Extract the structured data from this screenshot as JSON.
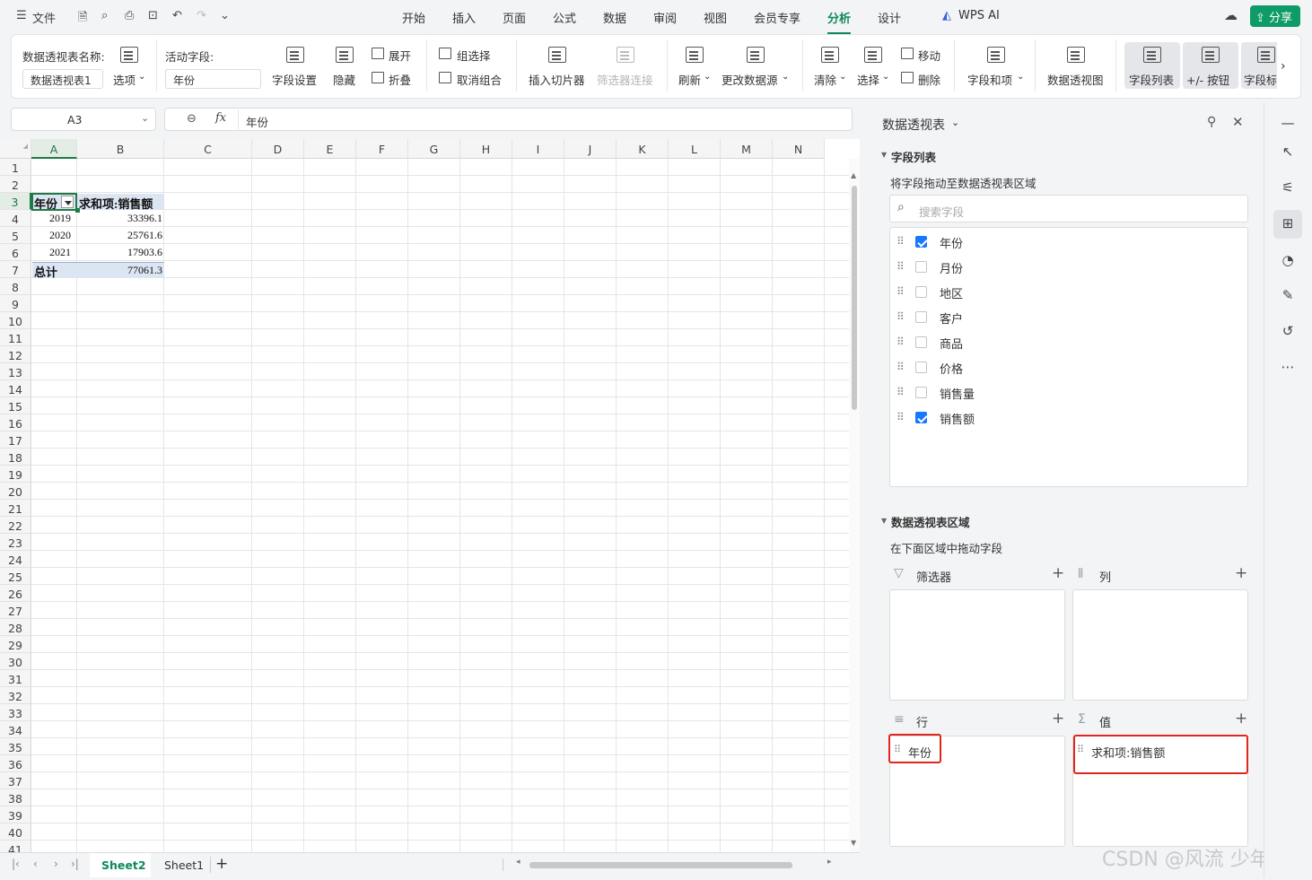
{
  "topbar": {
    "file_label": "文件",
    "tabs": [
      "开始",
      "插入",
      "页面",
      "公式",
      "数据",
      "审阅",
      "视图",
      "会员专享",
      "分析",
      "设计"
    ],
    "active_tab": "分析",
    "wps_ai": "WPS AI",
    "share": "分享"
  },
  "ribbon": {
    "pivot_name_label": "数据透视表名称:",
    "pivot_name_value": "数据透视表1",
    "options": "选项",
    "active_field_label": "活动字段:",
    "active_field_value": "年份",
    "field_settings": "字段设置",
    "hide": "隐藏",
    "expand": "展开",
    "collapse": "折叠",
    "group_selection": "组选择",
    "ungroup": "取消组合",
    "insert_slicer": "插入切片器",
    "filter_connection": "筛选器连接",
    "refresh": "刷新",
    "change_source": "更改数据源",
    "clear": "清除",
    "select": "选择",
    "move": "移动",
    "delete": "删除",
    "fields_items": "字段和项",
    "pivot_chart": "数据透视图",
    "field_list": "字段列表",
    "plus_minus": "+/- 按钮",
    "field_headers": "字段标"
  },
  "formula": {
    "cell_ref": "A3",
    "fx": "fx",
    "value": "年份"
  },
  "sheet": {
    "columns": [
      "A",
      "B",
      "C",
      "D",
      "E",
      "F",
      "G",
      "H",
      "I",
      "J",
      "K",
      "L",
      "M",
      "N"
    ],
    "rows": [
      "1",
      "2",
      "3",
      "4",
      "5",
      "6",
      "7",
      "8",
      "9",
      "10",
      "11",
      "12",
      "13",
      "14",
      "15",
      "16",
      "17",
      "18",
      "19",
      "20",
      "21",
      "22",
      "23",
      "24",
      "25",
      "26",
      "27",
      "28",
      "29",
      "30",
      "31",
      "32",
      "33",
      "34",
      "35",
      "36",
      "37",
      "38",
      "39",
      "40",
      "41"
    ],
    "pivot_header": [
      "年份",
      "求和项:销售额"
    ],
    "pivot_rows": [
      {
        "year": "2019",
        "value": "33396.1"
      },
      {
        "year": "2020",
        "value": "25761.6"
      },
      {
        "year": "2021",
        "value": "17903.6"
      }
    ],
    "total": {
      "label": "总计",
      "value": "77061.3"
    }
  },
  "sheet_tabs": [
    "Sheet2",
    "Sheet1"
  ],
  "panel": {
    "title": "数据透视表",
    "field_list_title": "字段列表",
    "field_list_hint": "将字段拖动至数据透视表区域",
    "search_placeholder": "搜索字段",
    "fields": [
      {
        "name": "年份",
        "checked": true
      },
      {
        "name": "月份",
        "checked": false
      },
      {
        "name": "地区",
        "checked": false
      },
      {
        "name": "客户",
        "checked": false
      },
      {
        "name": "商品",
        "checked": false
      },
      {
        "name": "价格",
        "checked": false
      },
      {
        "name": "销售量",
        "checked": false
      },
      {
        "name": "销售额",
        "checked": true
      }
    ],
    "areas_title": "数据透视表区域",
    "areas_hint": "在下面区域中拖动字段",
    "filter_label": "筛选器",
    "column_label": "列",
    "row_label": "行",
    "value_label": "值",
    "row_item": "年份",
    "value_item": "求和项:销售额"
  },
  "watermark": "CSDN @风流 少年"
}
